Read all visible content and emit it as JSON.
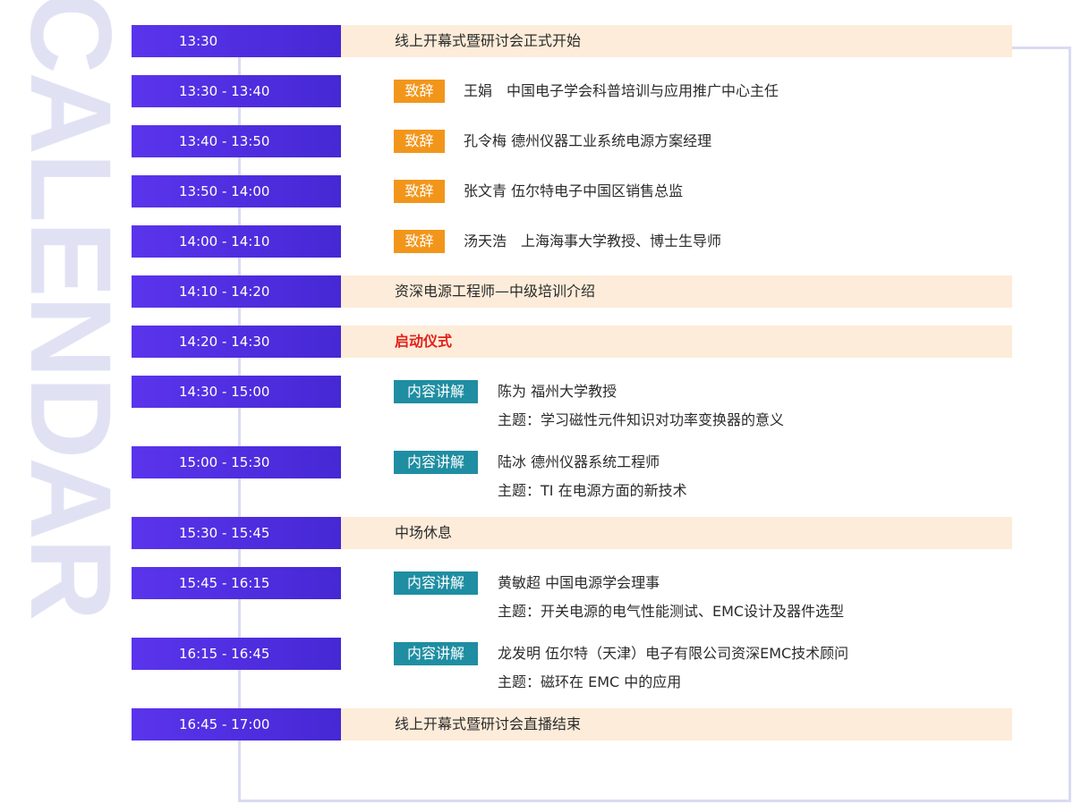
{
  "watermark": "CALENDAR",
  "rows": [
    {
      "time": "13:30",
      "title": "线上开幕式暨研讨会正式开始"
    },
    {
      "time": "13:30 - 13:40",
      "tag": "致辞",
      "speaker": "王娟　中国电子学会科普培训与应用推广中心主任"
    },
    {
      "time": "13:40 - 13:50",
      "tag": "致辞",
      "speaker": "孔令梅  德州仪器工业系统电源方案经理"
    },
    {
      "time": "13:50 - 14:00",
      "tag": "致辞",
      "speaker": "张文青   伍尔特电子中国区销售总监"
    },
    {
      "time": "14:00 - 14:10",
      "tag": "致辞",
      "speaker": "汤天浩　上海海事大学教授、博士生导师"
    },
    {
      "time": "14:10 - 14:20",
      "title": "资深电源工程师—中级培训介绍"
    },
    {
      "time": "14:20 - 14:30",
      "title": "启动仪式"
    },
    {
      "time": "14:30 - 15:00",
      "tag": "内容讲解",
      "speaker": "陈为   福州大学教授",
      "topic": "主题：学习磁性元件知识对功率变换器的意义"
    },
    {
      "time": "15:00 - 15:30",
      "tag": "内容讲解",
      "speaker": "陆冰   德州仪器系统工程师",
      "topic": "主题：TI 在电源方面的新技术"
    },
    {
      "time": "15:30 - 15:45",
      "title": "中场休息"
    },
    {
      "time": "15:45 - 16:15",
      "tag": "内容讲解",
      "speaker": "黄敏超   中国电源学会理事",
      "topic": "主题：开关电源的电气性能测试、EMC设计及器件选型"
    },
    {
      "time": "16:15 - 16:45",
      "tag": "内容讲解",
      "speaker": "龙发明   伍尔特（天津）电子有限公司资深EMC技术顾问",
      "topic": "主题：磁环在 EMC 中的应用"
    },
    {
      "time": "16:45 - 17:00",
      "title": "线上开幕式暨研讨会直播结束"
    }
  ]
}
